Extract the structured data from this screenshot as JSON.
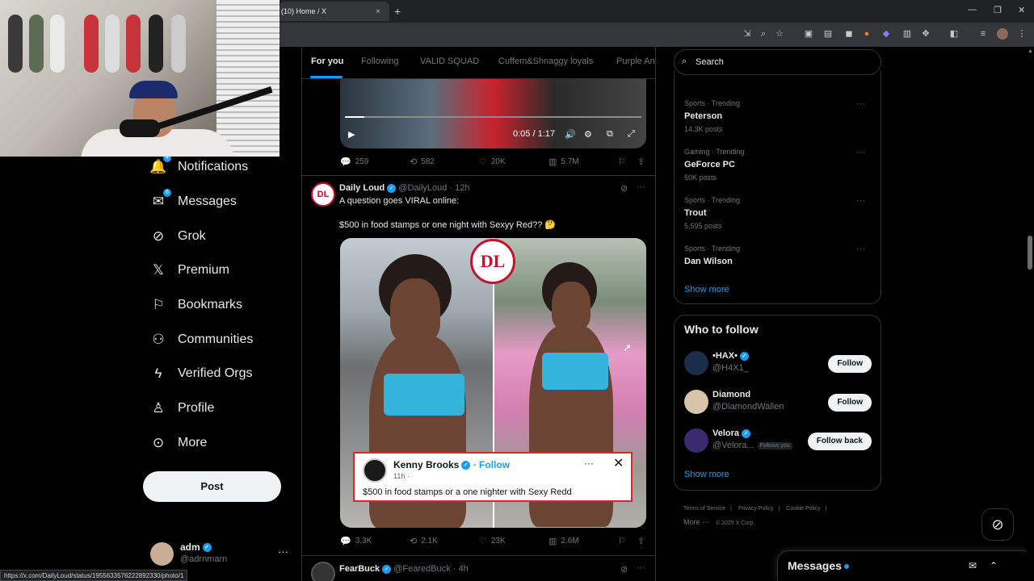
{
  "browser": {
    "tab_title": "(10) Home / X",
    "tab_close": "×",
    "new_tab": "+",
    "win_min": "—",
    "win_max": "❐",
    "win_close": "✕",
    "status_url": "https://x.com/DailyLoud/status/1955633576222892330/photo/1"
  },
  "nav": {
    "items": [
      {
        "label": "Notifications",
        "icon": "bell-icon",
        "glyph": "🔔",
        "badge": "4"
      },
      {
        "label": "Messages",
        "icon": "envelope-icon",
        "glyph": "✉",
        "badge": "6"
      },
      {
        "label": "Grok",
        "icon": "grok-icon",
        "glyph": "⊘"
      },
      {
        "label": "Premium",
        "icon": "x-logo-icon",
        "glyph": "𝕏"
      },
      {
        "label": "Bookmarks",
        "icon": "bookmark-icon",
        "glyph": "⚐"
      },
      {
        "label": "Communities",
        "icon": "communities-icon",
        "glyph": "⚇"
      },
      {
        "label": "Verified Orgs",
        "icon": "lightning-icon",
        "glyph": "ϟ"
      },
      {
        "label": "Profile",
        "icon": "person-icon",
        "glyph": "♙"
      },
      {
        "label": "More",
        "icon": "more-circle-icon",
        "glyph": "⊙"
      }
    ],
    "post_label": "Post",
    "account": {
      "name": "adm",
      "handle": "@adrnmarn",
      "more": "···"
    }
  },
  "feed": {
    "tabs": [
      "For you",
      "Following",
      "VALID SQUAD",
      "Cuffem&Shnaggy loyals",
      "Purple An"
    ],
    "video": {
      "time": "0:05 / 1:17",
      "progress": 0.065
    },
    "video_actions": {
      "replies": "259",
      "reposts": "582",
      "likes": "20K",
      "views": "5.7M"
    },
    "tweet": {
      "avatar_text": "DL",
      "name": "Daily Loud",
      "handle": "@DailyLoud",
      "time": "· 12h",
      "line1": "A question goes VIRAL online:",
      "line2": "$500 in food stamps or one night with Sexyy Red?? 🤔",
      "logo_text": "DL",
      "quote": {
        "name": "Kenny Brooks",
        "follow": "· Follow",
        "time": "11h ·",
        "text": "$500 in food stamps or a one nighter with Sexy Redd",
        "dots": "···",
        "close": "✕"
      },
      "actions": {
        "replies": "3.3K",
        "reposts": "2.1K",
        "likes": "23K",
        "views": "2.6M"
      }
    },
    "next_tweet": {
      "name": "FearBuck",
      "handle": "@FearedBuck",
      "time": "· 4h"
    }
  },
  "sidebar": {
    "search_placeholder": "Search",
    "trends": [
      {
        "category": "Sports · Trending",
        "title": "Peterson",
        "count": "14.3K posts"
      },
      {
        "category": "Gaming · Trending",
        "title": "GeForce PC",
        "count": "50K posts"
      },
      {
        "category": "Sports · Trending",
        "title": "Trout",
        "count": "5,595 posts"
      },
      {
        "category": "Sports · Trending",
        "title": "Dan Wilson",
        "count": ""
      }
    ],
    "show_more": "Show more",
    "who_to_follow": {
      "title": "Who to follow",
      "accounts": [
        {
          "name": "•HAX•",
          "handle": "@H4X1_",
          "button": "Follow",
          "verified": true,
          "color": "#1c2d4a"
        },
        {
          "name": "Diamond",
          "handle": "@DiamondWallen",
          "button": "Follow",
          "verified": false,
          "color": "#d8c4a8"
        },
        {
          "name": "Velora",
          "handle": "@Velora...",
          "button": "Follow back",
          "verified": true,
          "follows_you": "Follows you",
          "color": "#3b2a6e"
        }
      ],
      "show_more": "Show more"
    },
    "footer": [
      "Terms of Service",
      "|",
      "Privacy Policy",
      "|",
      "Cookie Policy",
      "|"
    ],
    "footer2": [
      "More ···",
      "© 2025 X Corp."
    ],
    "messages_title": "Messages"
  },
  "colors": {
    "accent": "#1d9bf0",
    "background": "#000000",
    "border": "#2f3336",
    "muted": "#71767b"
  }
}
